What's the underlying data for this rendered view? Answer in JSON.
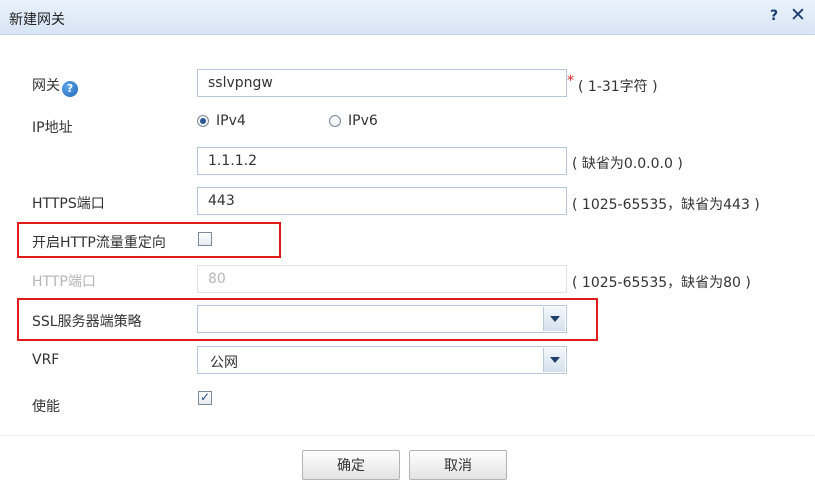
{
  "dialog": {
    "title": "新建网关",
    "help_label": "?",
    "close_label": "✕"
  },
  "form": {
    "gateway": {
      "label": "网关",
      "value": "sslvpngw",
      "required_mark": "*",
      "hint": "( 1-31字符 )"
    },
    "ip": {
      "label": "IP地址",
      "options": [
        {
          "label": "IPv4",
          "checked": true
        },
        {
          "label": "IPv6",
          "checked": false
        }
      ],
      "value": "1.1.1.2",
      "hint": "( 缺省为0.0.0.0 )"
    },
    "https_port": {
      "label": "HTTPS端口",
      "value": "443",
      "hint": "( 1025-65535，缺省为443 )"
    },
    "http_redirect": {
      "label": "开启HTTP流量重定向",
      "checked": false
    },
    "http_port": {
      "label": "HTTP端口",
      "value": "80",
      "hint": "( 1025-65535，缺省为80 )",
      "disabled": true
    },
    "ssl_policy": {
      "label": "SSL服务器端策略",
      "value": ""
    },
    "vrf": {
      "label": "VRF",
      "value": "公网"
    },
    "enable": {
      "label": "使能",
      "checked": true
    }
  },
  "buttons": {
    "ok": "确定",
    "cancel": "取消"
  },
  "colors": {
    "highlight": "#e01b1b",
    "titlebar": "#dbe8f6",
    "required": "#e02020"
  }
}
